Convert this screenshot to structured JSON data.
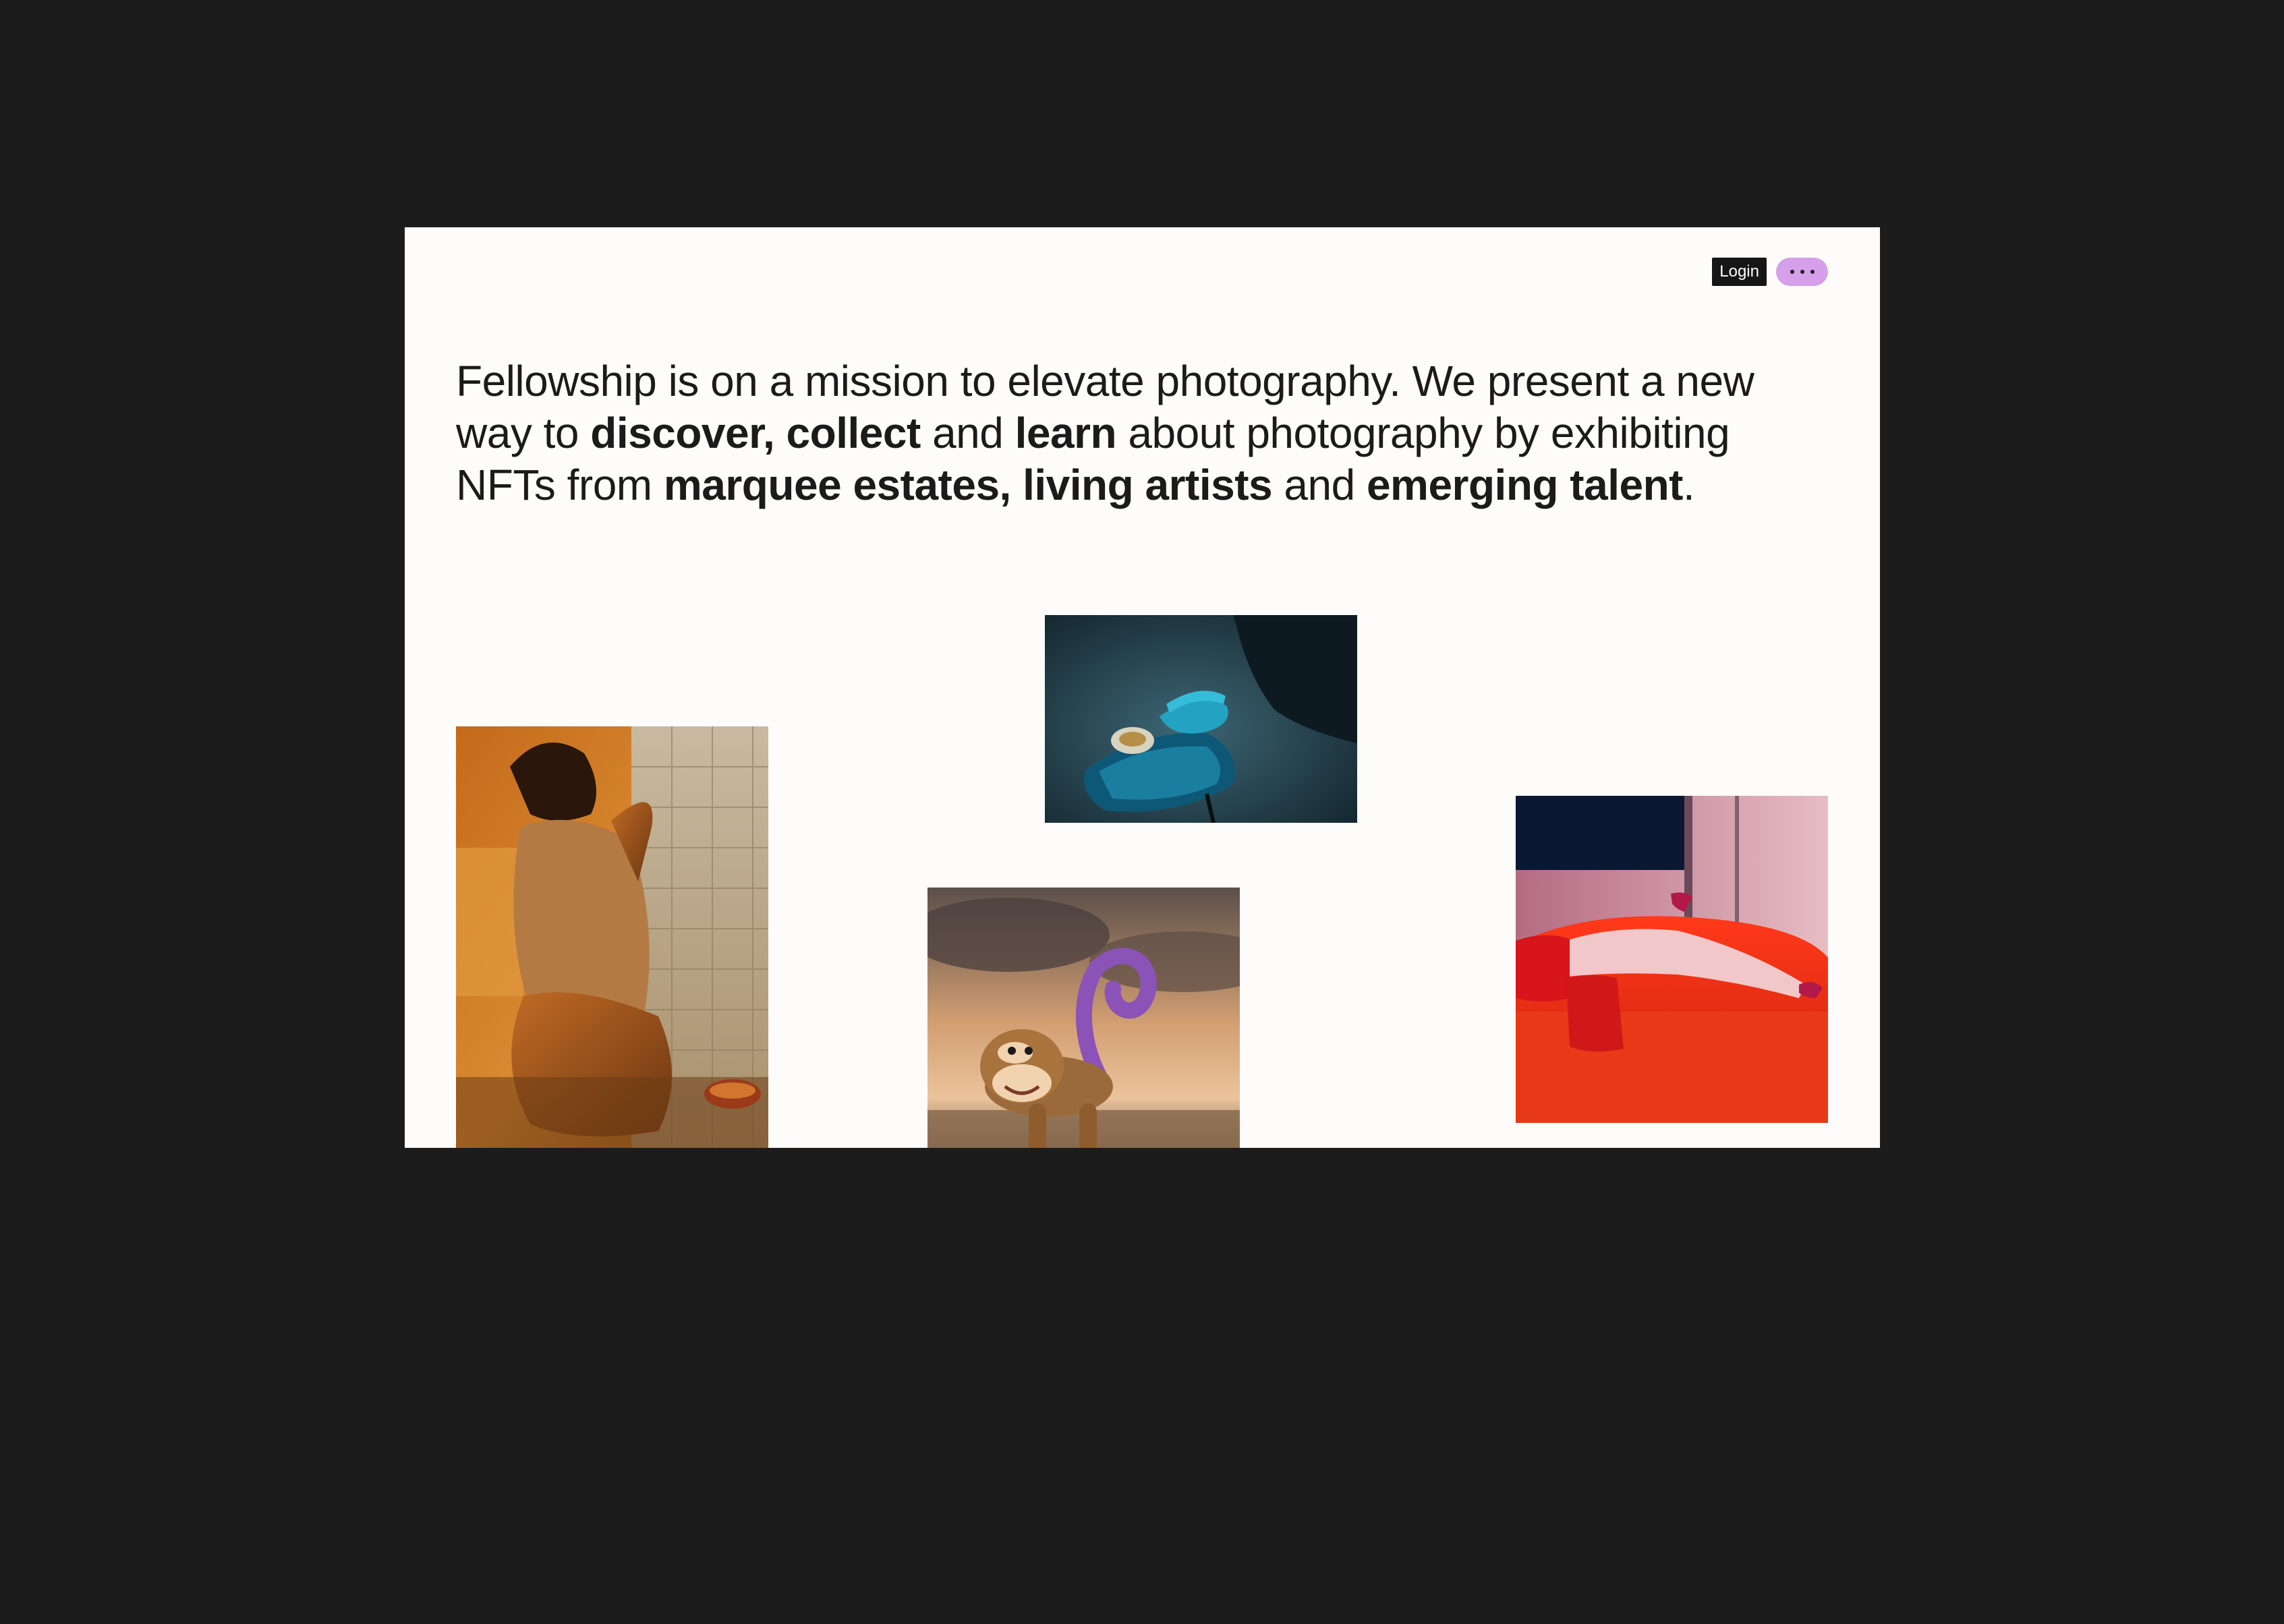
{
  "header": {
    "login_label": "Login",
    "menu_icon": "more-dots-icon",
    "menu_color": "#d59fea"
  },
  "mission": {
    "part1": "Fellowship is on a mission to elevate photography. We present a new way to ",
    "bold1": "discover, collect",
    "part2": " and ",
    "bold2": "learn",
    "part3": " about photography by exhibiting NFTs from ",
    "bold3": "marquee estates, living artists",
    "part4": " and ",
    "bold4": "emerging talent",
    "part5": "."
  },
  "gallery": {
    "items": [
      {
        "subject": "woman-in-tiled-bathroom-photo"
      },
      {
        "subject": "blue-telephone-on-cushion-photo"
      },
      {
        "subject": "balloon-monkey-photo"
      },
      {
        "subject": "legs-on-red-sofa-photo"
      }
    ]
  },
  "colors": {
    "background": "#1c1c1c",
    "page": "#fdfcfa",
    "text": "#1b1b1b",
    "accent": "#d59fea"
  }
}
